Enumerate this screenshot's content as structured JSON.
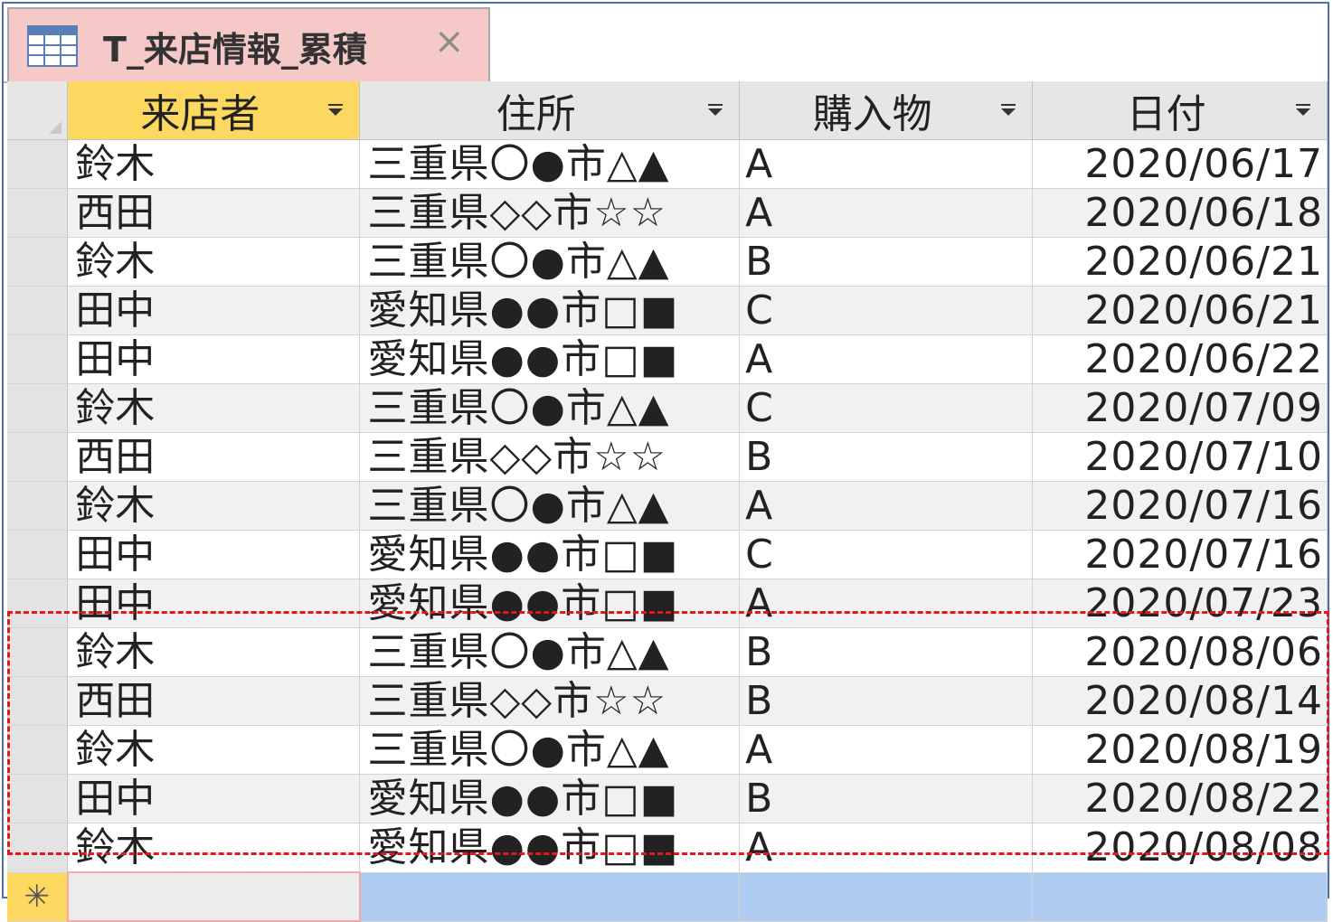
{
  "tab": {
    "title": "T_来店情報_累積",
    "close": "×",
    "icon": "table-icon"
  },
  "columns": [
    {
      "label": "来店者"
    },
    {
      "label": "住所"
    },
    {
      "label": "購入物"
    },
    {
      "label": "日付"
    }
  ],
  "rows": [
    {
      "name": "鈴木",
      "address": "三重県〇●市△▲",
      "item": "A",
      "date": "2020/06/17"
    },
    {
      "name": "西田",
      "address": "三重県◇◇市☆☆",
      "item": "A",
      "date": "2020/06/18"
    },
    {
      "name": "鈴木",
      "address": "三重県〇●市△▲",
      "item": "B",
      "date": "2020/06/21"
    },
    {
      "name": "田中",
      "address": "愛知県●●市□■",
      "item": "C",
      "date": "2020/06/21"
    },
    {
      "name": "田中",
      "address": "愛知県●●市□■",
      "item": "A",
      "date": "2020/06/22"
    },
    {
      "name": "鈴木",
      "address": "三重県〇●市△▲",
      "item": "C",
      "date": "2020/07/09"
    },
    {
      "name": "西田",
      "address": "三重県◇◇市☆☆",
      "item": "B",
      "date": "2020/07/10"
    },
    {
      "name": "鈴木",
      "address": "三重県〇●市△▲",
      "item": "A",
      "date": "2020/07/16"
    },
    {
      "name": "田中",
      "address": "愛知県●●市□■",
      "item": "C",
      "date": "2020/07/16"
    },
    {
      "name": "田中",
      "address": "愛知県●●市□■",
      "item": "A",
      "date": "2020/07/23"
    },
    {
      "name": "鈴木",
      "address": "三重県〇●市△▲",
      "item": "B",
      "date": "2020/08/06"
    },
    {
      "name": "西田",
      "address": "三重県◇◇市☆☆",
      "item": "B",
      "date": "2020/08/14"
    },
    {
      "name": "鈴木",
      "address": "三重県〇●市△▲",
      "item": "A",
      "date": "2020/08/19"
    },
    {
      "name": "田中",
      "address": "愛知県●●市□■",
      "item": "B",
      "date": "2020/08/22"
    },
    {
      "name": "鈴木",
      "address": "愛知県●●市□■",
      "item": "A",
      "date": "2020/08/08"
    }
  ],
  "new_row_marker": "✳",
  "colors": {
    "tab_bg": "#f6c9c9",
    "active_header": "#fdd861",
    "new_row": "#aecbf0",
    "highlight_border": "#e8141e",
    "frame_border": "#4f6fa8"
  }
}
